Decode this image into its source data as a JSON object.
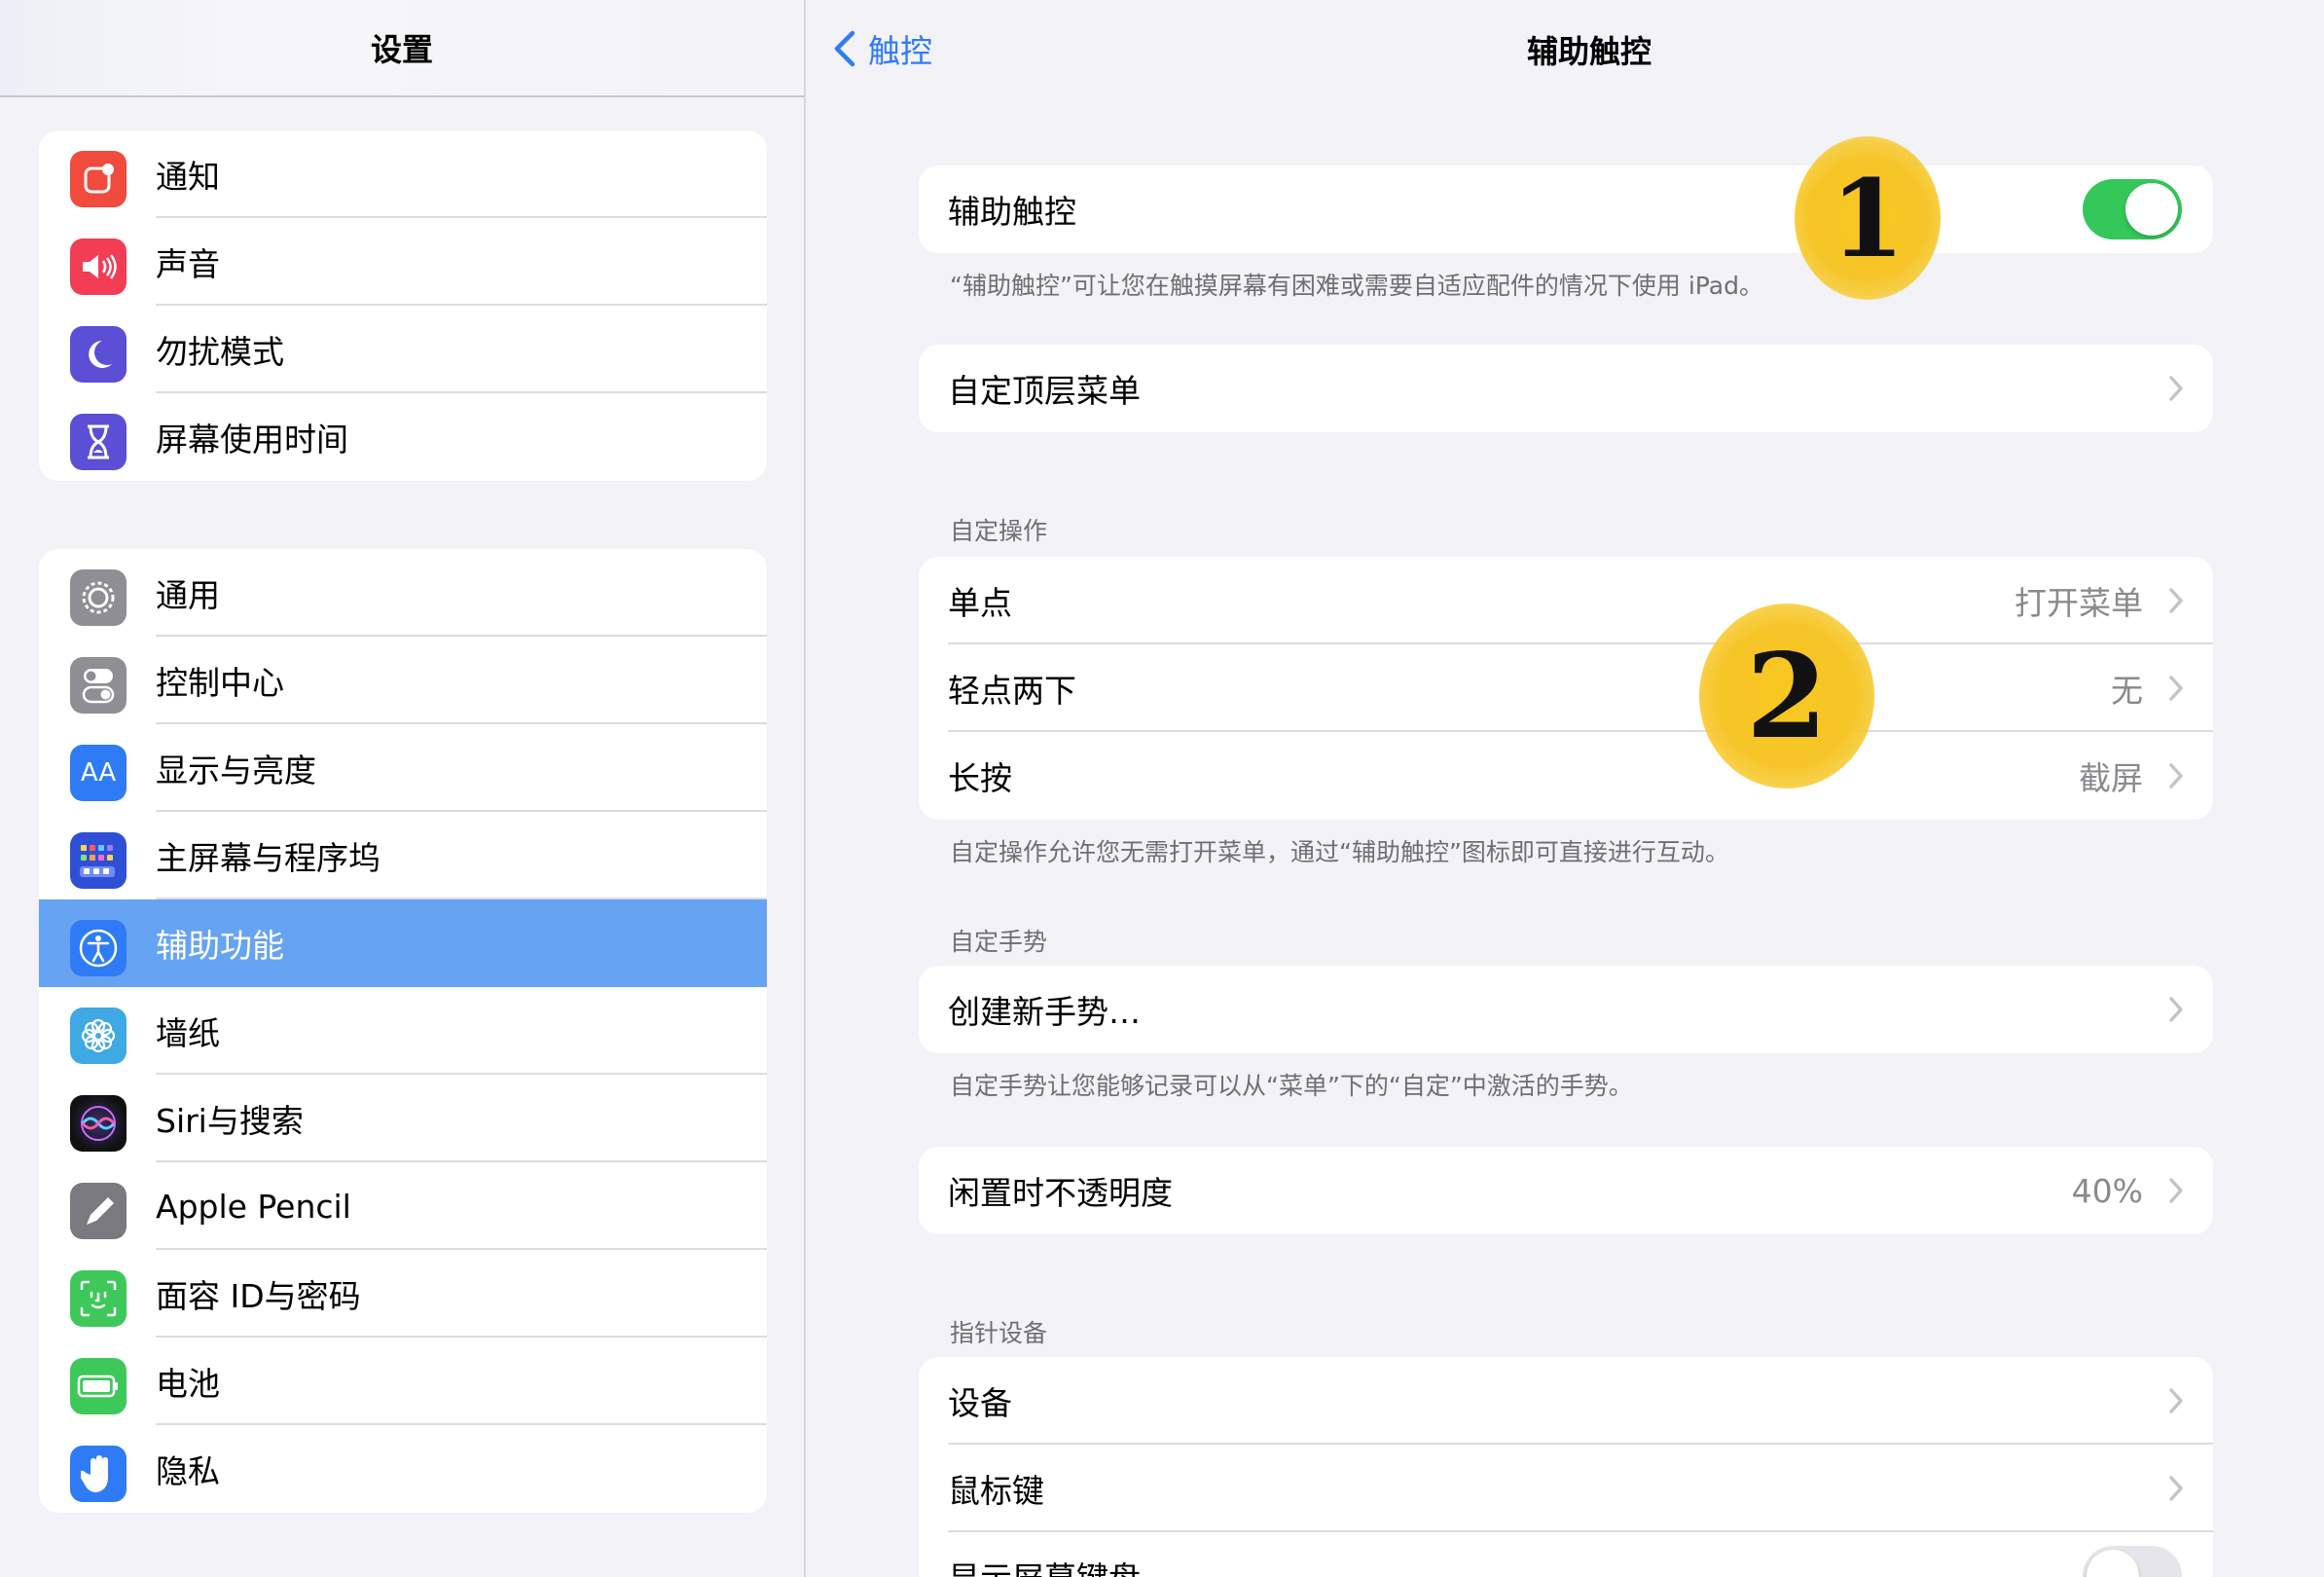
{
  "sidebar": {
    "title": "设置",
    "group1": [
      {
        "label": "通知",
        "icon": "notifications-icon",
        "color": "#f04b3c"
      },
      {
        "label": "声音",
        "icon": "sound-icon",
        "color": "#f23d55"
      },
      {
        "label": "勿扰模式",
        "icon": "moon-icon",
        "color": "#5b4fd6"
      },
      {
        "label": "屏幕使用时间",
        "icon": "hourglass-icon",
        "color": "#5b4fd6"
      }
    ],
    "group2": [
      {
        "label": "通用",
        "icon": "gear-icon",
        "color": "#8e8e93"
      },
      {
        "label": "控制中心",
        "icon": "toggles-icon",
        "color": "#8e8e93"
      },
      {
        "label": "显示与亮度",
        "icon": "display-icon",
        "color": "#2f7bf6"
      },
      {
        "label": "主屏幕与程序坞",
        "icon": "home-grid-icon",
        "color": "#2f4fd6"
      },
      {
        "label": "辅助功能",
        "icon": "accessibility-icon",
        "color": "#2f7bf6"
      },
      {
        "label": "墙纸",
        "icon": "flower-icon",
        "color": "#3fa9e3"
      },
      {
        "label": "Siri与搜索",
        "icon": "siri-icon",
        "color": "#1c1c1e"
      },
      {
        "label": "Apple Pencil",
        "icon": "pencil-icon",
        "color": "#7a7a7e"
      },
      {
        "label": "面容 ID与密码",
        "icon": "faceid-icon",
        "color": "#3ec85a"
      },
      {
        "label": "电池",
        "icon": "battery-icon",
        "color": "#3ec85a"
      },
      {
        "label": "隐私",
        "icon": "hand-icon",
        "color": "#2f7bf6"
      }
    ],
    "selected": "辅助功能"
  },
  "detail": {
    "back_label": "触控",
    "title": "辅助触控",
    "assistive": {
      "label": "辅助触控",
      "on": true,
      "note": "“辅助触控”可让您在触摸屏幕有困难或需要自适应配件的情况下使用 iPad。"
    },
    "top_menu": {
      "label": "自定顶层菜单"
    },
    "custom_actions": {
      "header": "自定操作",
      "rows": [
        {
          "label": "单点",
          "value": "打开菜单"
        },
        {
          "label": "轻点两下",
          "value": "无"
        },
        {
          "label": "长按",
          "value": "截屏"
        }
      ],
      "note": "自定操作允许您无需打开菜单，通过“辅助触控”图标即可直接进行互动。"
    },
    "custom_gestures": {
      "header": "自定手势",
      "create_label": "创建新手势…",
      "note": "自定手势让您能够记录可以从“菜单”下的“自定”中激活的手势。"
    },
    "idle_opacity": {
      "label": "闲置时不透明度",
      "value": "40%"
    },
    "pointer": {
      "header": "指针设备",
      "rows": [
        {
          "label": "设备"
        },
        {
          "label": "鼠标键"
        },
        {
          "label": "显示屏幕键盘"
        }
      ]
    }
  },
  "markers": [
    "1",
    "2"
  ],
  "colors": {
    "accent": "#2f7bf6",
    "toggle_on": "#34c759",
    "selected_row": "#66a3f3",
    "marker": "#f6c52a"
  }
}
